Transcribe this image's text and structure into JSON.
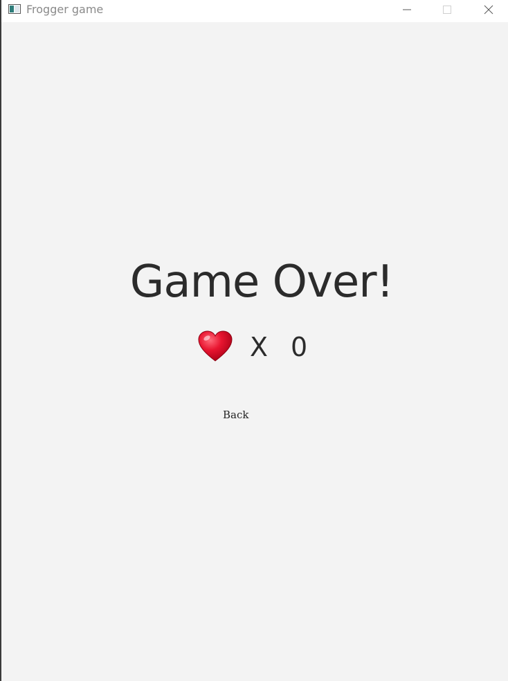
{
  "window": {
    "title": "Frogger game",
    "icon": "app-window-icon",
    "controls": [
      "minimize-icon",
      "maximize-icon",
      "close-icon"
    ]
  },
  "screen": {
    "heading": "Game Over!",
    "lives": {
      "icon": "heart-icon",
      "separator": "X",
      "count": "0"
    },
    "back_label": "Back"
  },
  "colors": {
    "background": "#f3f3f3",
    "text": "#2b2b2b",
    "heart": "#e0132b"
  }
}
